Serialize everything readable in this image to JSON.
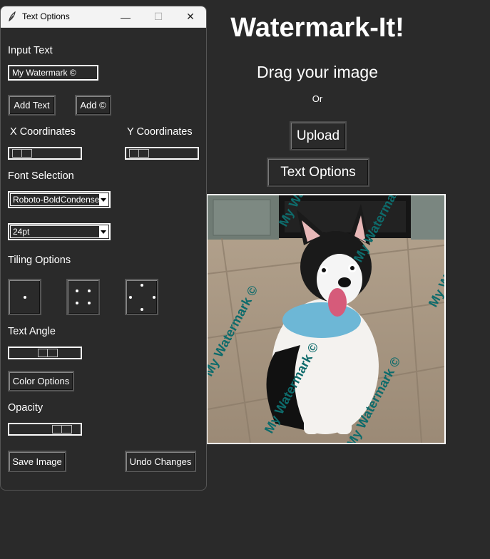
{
  "main": {
    "title": "Watermark-It!",
    "drag_text": "Drag your image",
    "or_text": "Or",
    "upload_label": "Upload",
    "text_options_label": "Text Options",
    "watermark_overlay": "My Watermark ©"
  },
  "dialog": {
    "title": "Text Options",
    "window_controls": {
      "minimize": "—",
      "maximize": "☐",
      "close": "✕"
    },
    "input_text_label": "Input Text",
    "input_text_value": "My Watermark ©",
    "add_text_label": "Add Text",
    "add_copyright_label": "Add ©",
    "x_coord_label": "X Coordinates",
    "y_coord_label": "Y Coordinates",
    "x_slider_value": 0.05,
    "y_slider_value": 0.05,
    "font_selection_label": "Font Selection",
    "font_value": "Roboto-BoldCondensed",
    "size_value": "24pt",
    "tiling_label": "Tiling Options",
    "text_angle_label": "Text Angle",
    "angle_slider_value": 0.55,
    "color_options_label": "Color Options",
    "opacity_label": "Opacity",
    "opacity_slider_value": 0.83,
    "save_label": "Save Image",
    "undo_label": "Undo Changes"
  },
  "colors": {
    "background": "#2a2a2a",
    "watermark": "#0e6b6b"
  }
}
